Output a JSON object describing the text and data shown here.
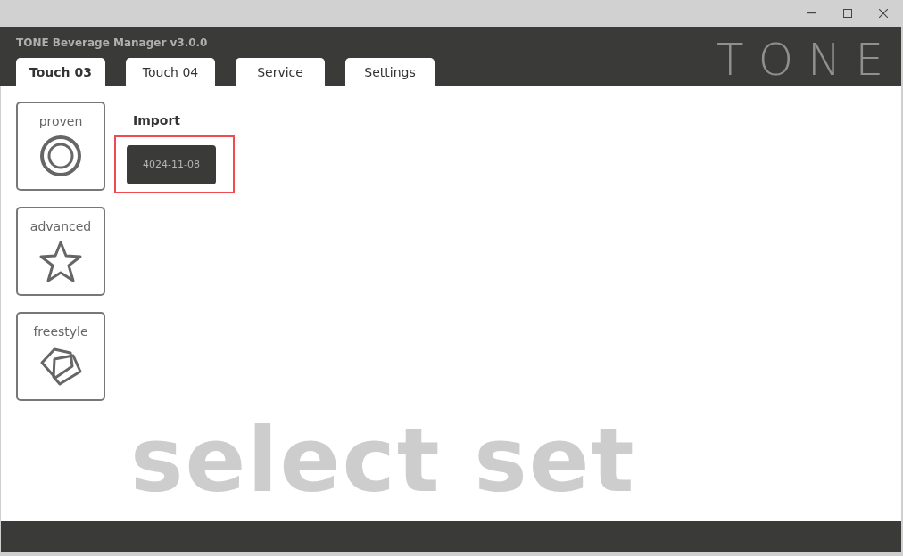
{
  "window": {
    "title": "TONE Beverage Manager v3.0.0",
    "logo": "TONE"
  },
  "tabs": [
    {
      "label": "Touch 03",
      "selected": true
    },
    {
      "label": "Touch 04",
      "selected": false
    },
    {
      "label": "Service",
      "selected": false
    },
    {
      "label": "Settings",
      "selected": false
    }
  ],
  "modes": [
    {
      "label": "proven",
      "kind": "circle"
    },
    {
      "label": "advanced",
      "kind": "star"
    },
    {
      "label": "freestyle",
      "kind": "polygons"
    }
  ],
  "import": {
    "heading": "Import",
    "sets": [
      {
        "label": "4024-11-08",
        "highlighted": true
      }
    ]
  },
  "background_text": "select set"
}
